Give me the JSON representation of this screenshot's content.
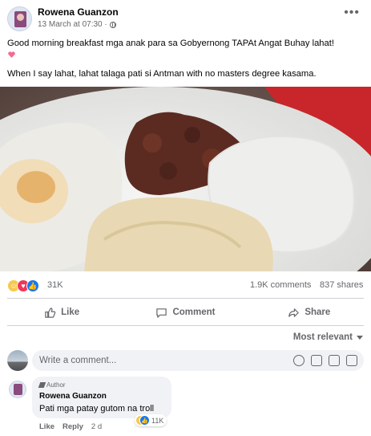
{
  "post": {
    "author": "Rowena Guanzon",
    "timestamp": "13 March at 07:30 ·",
    "privacy_icon": "globe-icon",
    "more_icon": "more-options-icon",
    "text_line1": "Good morning breakfast mga anak para sa Gobyernong TAPAt Angat Buhay lahat!",
    "text_line2": "When I say lahat, lahat talaga pati si Antman with no masters degree kasama.",
    "image": "breakfast plate with fried egg, beef tapa, garlic rice and white cheese"
  },
  "stats": {
    "reaction_icons": [
      "haha-icon",
      "love-icon",
      "like-icon"
    ],
    "reactions": "31K",
    "comments": "1.9K comments",
    "shares": "837 shares"
  },
  "actions": {
    "like": "Like",
    "comment": "Comment",
    "share": "Share"
  },
  "comments_section": {
    "sort_label": "Most relevant",
    "placeholder": "Write a comment..."
  },
  "top_comment": {
    "badge": "Author",
    "author": "Rowena Guanzon",
    "text": "Pati mga patay gutom na troll",
    "reactions": "11K",
    "like": "Like",
    "reply": "Reply",
    "time": "2 d"
  },
  "colors": {
    "text": "#050505",
    "secondary": "#65676b",
    "like_blue": "#1877f2",
    "love_red": "#f0365a",
    "haha_yellow": "#f7c94a",
    "input_bg": "#f0f2f5"
  }
}
